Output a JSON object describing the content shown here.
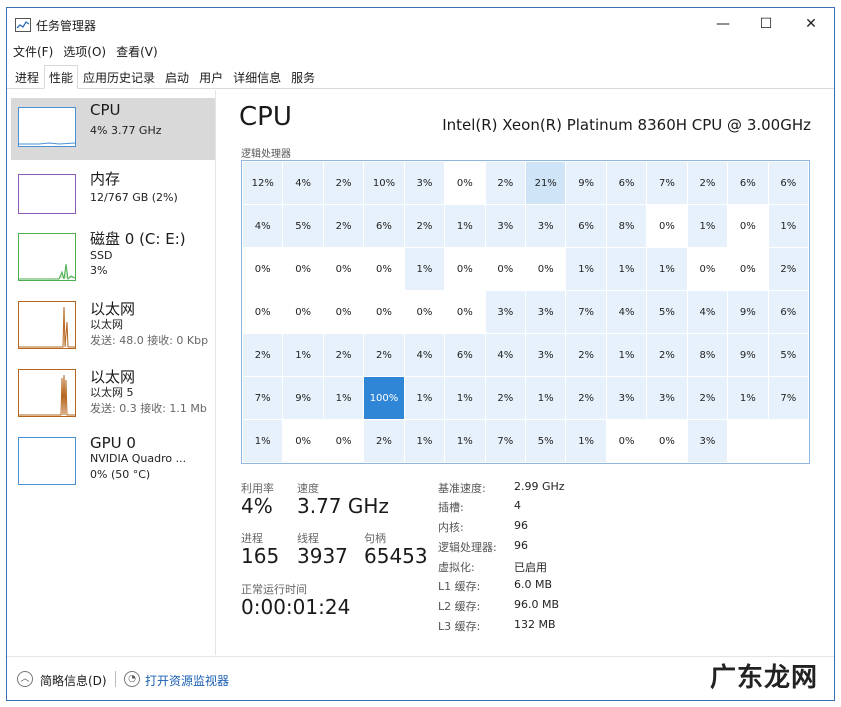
{
  "window": {
    "title": "任务管理器",
    "minimize": "—",
    "maximize": "☐",
    "close": "✕"
  },
  "menu": [
    "文件(F)",
    "选项(O)",
    "查看(V)"
  ],
  "tabs": [
    "进程",
    "性能",
    "应用历史记录",
    "启动",
    "用户",
    "详细信息",
    "服务"
  ],
  "active_tab": 1,
  "sidebar": [
    {
      "name": "CPU",
      "line1": "4% 3.77 GHz",
      "line2": "",
      "line3": "",
      "active": true,
      "color": "#4a90d9"
    },
    {
      "name": "内存",
      "line1": "12/767 GB (2%)",
      "line2": "",
      "line3": "",
      "active": false,
      "color": "#8b5cb5"
    },
    {
      "name": "磁盘 0 (C: E:)",
      "line1": "SSD",
      "line2": "3%",
      "line3": "",
      "active": false,
      "color": "#4caf50"
    },
    {
      "name": "以太网",
      "line1": "以太网",
      "line2": "发送: 48.0 接收: 0 Kbp",
      "line3": "",
      "active": false,
      "color": "#b5651d"
    },
    {
      "name": "以太网",
      "line1": "以太网 5",
      "line2": "发送: 0.3 接收: 1.1 Mb",
      "line3": "",
      "active": false,
      "color": "#b5651d"
    },
    {
      "name": "GPU 0",
      "line1": "NVIDIA Quadro ...",
      "line2": "0% (50 °C)",
      "line3": "",
      "active": false,
      "color": "#4a90d9"
    }
  ],
  "cpu": {
    "title": "CPU",
    "model": "Intel(R) Xeon(R) Platinum 8360H CPU @ 3.00GHz",
    "logical_label": "逻辑处理器",
    "cores": [
      "12%",
      "4%",
      "2%",
      "10%",
      "3%",
      "0%",
      "2%",
      "21%",
      "9%",
      "6%",
      "7%",
      "2%",
      "6%",
      "6%",
      "4%",
      "5%",
      "2%",
      "6%",
      "2%",
      "1%",
      "3%",
      "3%",
      "6%",
      "8%",
      "0%",
      "1%",
      "0%",
      "1%",
      "0%",
      "0%",
      "0%",
      "0%",
      "1%",
      "0%",
      "0%",
      "0%",
      "1%",
      "1%",
      "1%",
      "0%",
      "0%",
      "2%",
      "0%",
      "0%",
      "0%",
      "0%",
      "0%",
      "0%",
      "3%",
      "3%",
      "7%",
      "4%",
      "5%",
      "4%",
      "9%",
      "6%",
      "2%",
      "1%",
      "2%",
      "2%",
      "4%",
      "6%",
      "4%",
      "3%",
      "2%",
      "1%",
      "2%",
      "8%",
      "9%",
      "5%",
      "7%",
      "9%",
      "1%",
      "100%",
      "1%",
      "1%",
      "2%",
      "1%",
      "2%",
      "3%",
      "3%",
      "2%",
      "1%",
      "7%",
      "1%",
      "0%",
      "0%",
      "2%",
      "1%",
      "1%",
      "7%",
      "5%",
      "1%",
      "0%",
      "0%",
      "3%",
      "",
      ""
    ]
  },
  "stats": {
    "util_label": "利用率",
    "util": "4%",
    "speed_label": "速度",
    "speed": "3.77 GHz",
    "proc_label": "进程",
    "proc": "165",
    "thread_label": "线程",
    "thread": "3937",
    "handle_label": "句柄",
    "handle": "65453",
    "uptime_label": "正常运行时间",
    "uptime": "0:00:01:24"
  },
  "specs": [
    {
      "k": "基准速度:",
      "v": "2.99 GHz"
    },
    {
      "k": "插槽:",
      "v": "4"
    },
    {
      "k": "内核:",
      "v": "96"
    },
    {
      "k": "逻辑处理器:",
      "v": "96"
    },
    {
      "k": "虚拟化:",
      "v": "已启用"
    },
    {
      "k": "L1 缓存:",
      "v": "6.0 MB"
    },
    {
      "k": "L2 缓存:",
      "v": "96.0 MB"
    },
    {
      "k": "L3 缓存:",
      "v": "132 MB"
    }
  ],
  "bottom": {
    "brief": "简略信息(D)",
    "monitor": "打开资源监视器"
  },
  "watermark": "广东龙网"
}
